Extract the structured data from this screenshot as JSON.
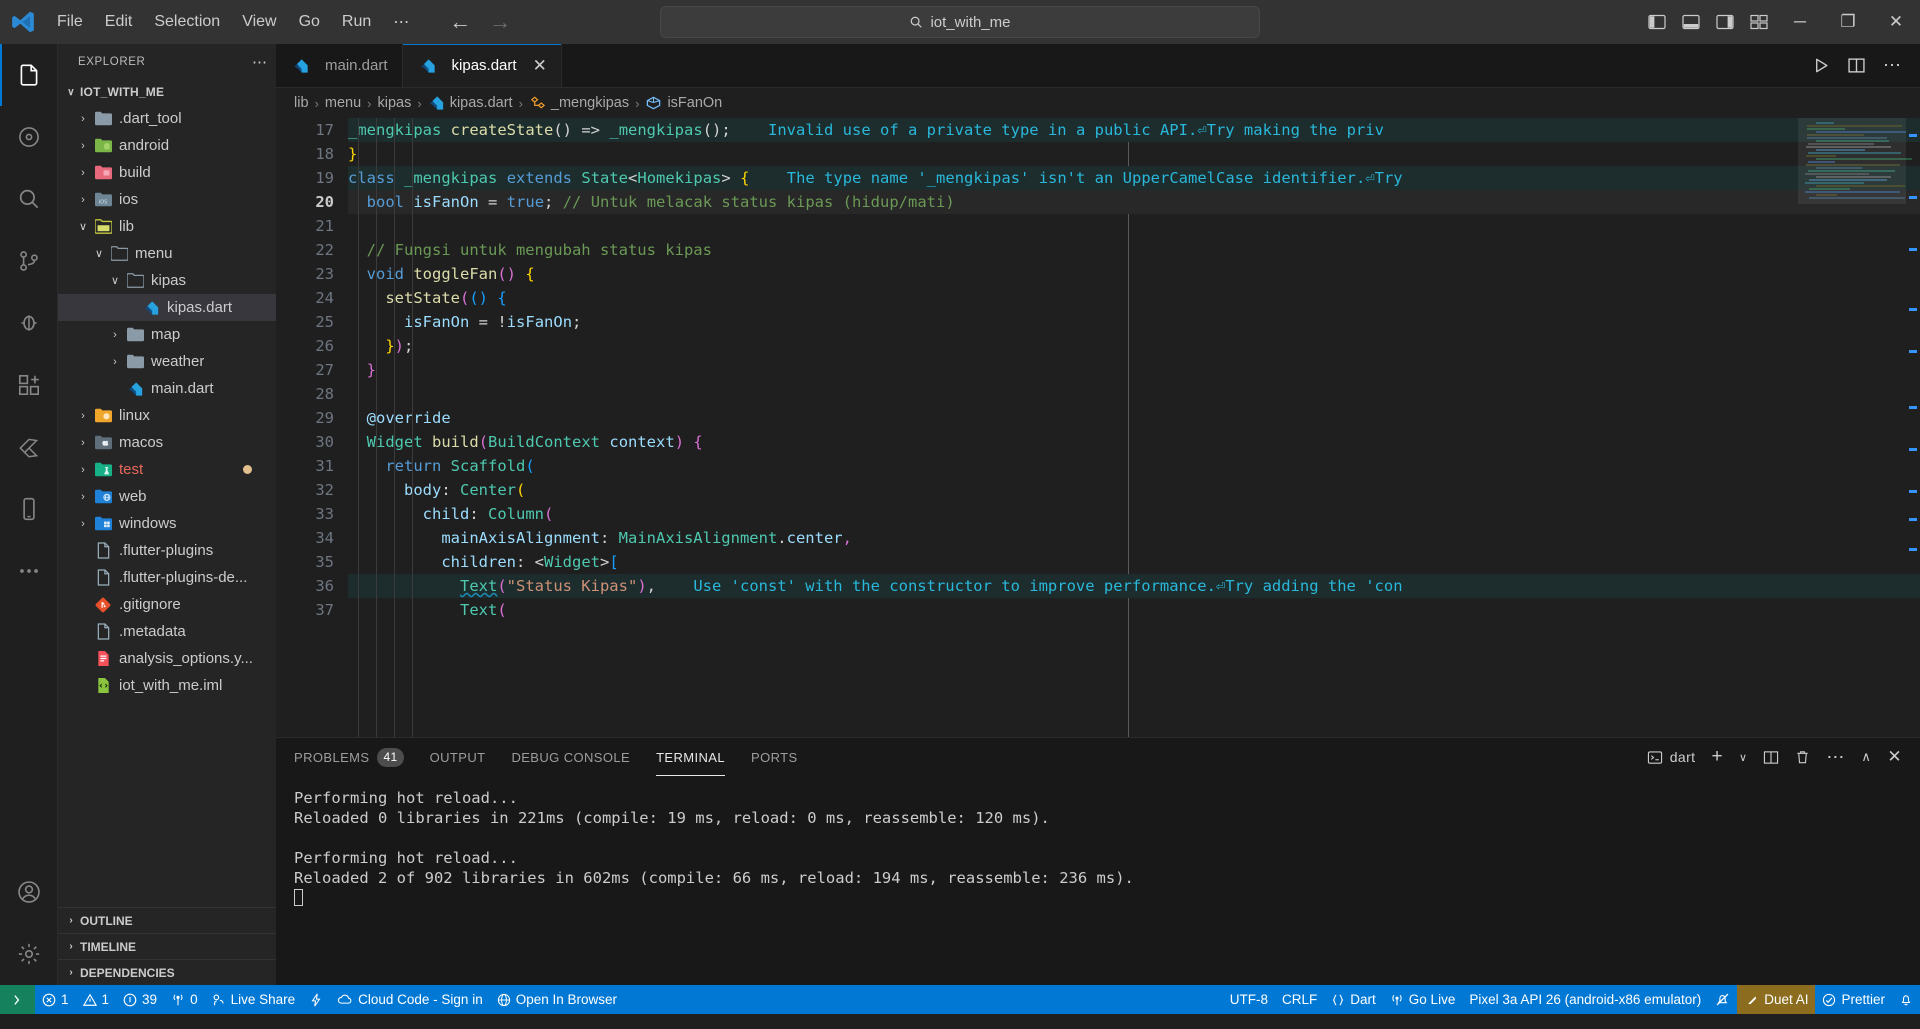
{
  "titlebar": {
    "logo": "vscode-logo",
    "menus": [
      "File",
      "Edit",
      "Selection",
      "View",
      "Go",
      "Run",
      "⋯"
    ],
    "nav_back": "←",
    "nav_forward": "→",
    "quickopen_text": "iot_with_me",
    "quickopen_icon": "search-icon",
    "window_controls": [
      "─",
      "❐",
      "✕"
    ]
  },
  "activitybar": {
    "items": [
      {
        "name": "explorer",
        "icon": "files-icon",
        "active": true,
        "badge": ""
      },
      {
        "name": "source-control-graph",
        "icon": "circle-nodes-icon",
        "active": false,
        "badge": ""
      },
      {
        "name": "search",
        "icon": "search-icon",
        "active": false,
        "badge": ""
      },
      {
        "name": "source-control",
        "icon": "source-control-icon",
        "active": false,
        "badge": ""
      },
      {
        "name": "run-and-debug",
        "icon": "debug-icon",
        "active": false,
        "badge": ""
      },
      {
        "name": "extensions",
        "icon": "extensions-icon",
        "active": false,
        "badge": ""
      },
      {
        "name": "flutter",
        "icon": "flutter-icon",
        "active": false,
        "badge": ""
      },
      {
        "name": "device-preview",
        "icon": "device-icon",
        "active": false,
        "badge": ""
      },
      {
        "name": "more-views",
        "icon": "ellipsis-icon",
        "active": false,
        "badge": ""
      }
    ],
    "bottom": [
      {
        "name": "accounts",
        "icon": "account-icon"
      },
      {
        "name": "settings",
        "icon": "gear-icon"
      }
    ]
  },
  "sidebar": {
    "title": "EXPLORER",
    "more_actions": "⋯",
    "root": "IOT_WITH_ME",
    "tree": [
      {
        "label": ".dart_tool",
        "depth": 1,
        "twist": "›",
        "icon": "folder-blue-gray",
        "selected": false,
        "modified": false
      },
      {
        "label": "android",
        "depth": 1,
        "twist": "›",
        "icon": "folder-android",
        "selected": false,
        "modified": false
      },
      {
        "label": "build",
        "depth": 1,
        "twist": "›",
        "icon": "folder-build",
        "selected": false,
        "modified": false
      },
      {
        "label": "ios",
        "depth": 1,
        "twist": "›",
        "icon": "folder-ios",
        "selected": false,
        "modified": false
      },
      {
        "label": "lib",
        "depth": 1,
        "twist": "∨",
        "icon": "folder-lib",
        "selected": false,
        "modified": false
      },
      {
        "label": "menu",
        "depth": 2,
        "twist": "∨",
        "icon": "folder-open-gray",
        "selected": false,
        "modified": false
      },
      {
        "label": "kipas",
        "depth": 3,
        "twist": "∨",
        "icon": "folder-open-gray",
        "selected": false,
        "modified": false
      },
      {
        "label": "kipas.dart",
        "depth": 4,
        "twist": "",
        "icon": "dart-file",
        "selected": true,
        "modified": false
      },
      {
        "label": "map",
        "depth": 3,
        "twist": "›",
        "icon": "folder-blue-gray",
        "selected": false,
        "modified": false
      },
      {
        "label": "weather",
        "depth": 3,
        "twist": "›",
        "icon": "folder-blue-gray",
        "selected": false,
        "modified": false
      },
      {
        "label": "main.dart",
        "depth": 3,
        "twist": "",
        "icon": "dart-file",
        "selected": false,
        "modified": false
      },
      {
        "label": "linux",
        "depth": 1,
        "twist": "›",
        "icon": "folder-linux",
        "selected": false,
        "modified": false
      },
      {
        "label": "macos",
        "depth": 1,
        "twist": "›",
        "icon": "folder-macos",
        "selected": false,
        "modified": false
      },
      {
        "label": "test",
        "depth": 1,
        "twist": "›",
        "icon": "folder-test",
        "selected": false,
        "modified": true
      },
      {
        "label": "web",
        "depth": 1,
        "twist": "›",
        "icon": "folder-web",
        "selected": false,
        "modified": false
      },
      {
        "label": "windows",
        "depth": 1,
        "twist": "›",
        "icon": "folder-windows",
        "selected": false,
        "modified": false
      },
      {
        "label": ".flutter-plugins",
        "depth": 1,
        "twist": "",
        "icon": "plain-file",
        "selected": false,
        "modified": false
      },
      {
        "label": ".flutter-plugins-de...",
        "depth": 1,
        "twist": "",
        "icon": "plain-file",
        "selected": false,
        "modified": false
      },
      {
        "label": ".gitignore",
        "depth": 1,
        "twist": "",
        "icon": "git-file",
        "selected": false,
        "modified": false
      },
      {
        "label": ".metadata",
        "depth": 1,
        "twist": "",
        "icon": "plain-file",
        "selected": false,
        "modified": false
      },
      {
        "label": "analysis_options.y...",
        "depth": 1,
        "twist": "",
        "icon": "yaml-file",
        "selected": false,
        "modified": false
      },
      {
        "label": "iot_with_me.iml",
        "depth": 1,
        "twist": "",
        "icon": "xml-file",
        "selected": false,
        "modified": false
      }
    ],
    "sections": [
      "OUTLINE",
      "TIMELINE",
      "DEPENDENCIES"
    ]
  },
  "editor": {
    "tabs": [
      {
        "label": "main.dart",
        "icon": "dart-file",
        "active": false,
        "closable": false
      },
      {
        "label": "kipas.dart",
        "icon": "dart-file",
        "active": true,
        "closable": true
      }
    ],
    "tab_actions": [
      "run-icon",
      "split-editor-icon",
      "more-actions-icon"
    ],
    "breadcrumb": [
      {
        "label": "lib",
        "icon": ""
      },
      {
        "label": "menu",
        "icon": ""
      },
      {
        "label": "kipas",
        "icon": ""
      },
      {
        "label": "kipas.dart",
        "icon": "dart-file"
      },
      {
        "label": "_mengkipas",
        "icon": "class-icon"
      },
      {
        "label": "isFanOn",
        "icon": "field-icon"
      }
    ],
    "first_line_number": 17,
    "cursor_line": 20,
    "lines": [
      {
        "n": 17,
        "html": "<span class='kw-type'>_mengkipas</span> <span class='fn'>createState</span><span class='punc'>()</span> <span class='op'>=&gt;</span> <span class='kw-type'>_mengkipas</span><span class='punc'>();</span>",
        "diag": "Invalid use of a private type in a public API.⏎Try making the priv",
        "hl": true
      },
      {
        "n": 18,
        "html": "<span class='punc-y'>}</span>",
        "diag": "",
        "hl": false
      },
      {
        "n": 19,
        "html": "<span class='kw'>class</span> <span class='kw-type'>_mengkipas</span> <span class='kw'>extends</span> <span class='kw-type'>State</span><span class='punc'>&lt;</span><span class='kw-type'>Homekipas</span><span class='punc'>&gt;</span> <span class='punc-y'>{</span>",
        "diag": "The type name '_mengkipas' isn't an UpperCamelCase identifier.⏎Try",
        "hl": true
      },
      {
        "n": 20,
        "html": "  <span class='kw'>bool</span> <span class='var'>isFanOn</span> <span class='op'>=</span> <span class='kw'>true</span><span class='punc'>;</span> <span class='cmt'>// Untuk melacak status kipas (hidup/mati)</span>",
        "diag": "",
        "hl": false
      },
      {
        "n": 21,
        "html": "",
        "diag": "",
        "hl": false
      },
      {
        "n": 22,
        "html": "  <span class='cmt'>// Fungsi untuk mengubah status kipas</span>",
        "diag": "",
        "hl": false
      },
      {
        "n": 23,
        "html": "  <span class='kw'>void</span> <span class='fn'>toggleFan</span><span class='punc-p'>()</span> <span class='punc-y'>{</span>",
        "diag": "",
        "hl": false
      },
      {
        "n": 24,
        "html": "    <span class='fn'>setState</span><span class='punc-p'>(</span><span class='punc-b'>()</span> <span class='punc-b'>{</span>",
        "diag": "",
        "hl": false
      },
      {
        "n": 25,
        "html": "      <span class='var'>isFanOn</span> <span class='op'>=</span> <span class='op'>!</span><span class='var'>isFanOn</span><span class='punc'>;</span>",
        "diag": "",
        "hl": false
      },
      {
        "n": 26,
        "html": "    <span class='punc-y'>}</span><span class='punc-p'>)</span><span class='punc'>;</span>",
        "diag": "",
        "hl": false
      },
      {
        "n": 27,
        "html": "  <span class='punc-p'>}</span>",
        "diag": "",
        "hl": false
      },
      {
        "n": 28,
        "html": "",
        "diag": "",
        "hl": false
      },
      {
        "n": 29,
        "html": "  <span class='ann'>@override</span>",
        "diag": "",
        "hl": false
      },
      {
        "n": 30,
        "html": "  <span class='kw-type'>Widget</span> <span class='fn'>build</span><span class='punc-p'>(</span><span class='kw-type'>BuildContext</span> <span class='var'>context</span><span class='punc-p'>)</span> <span class='punc-p'>{</span>",
        "diag": "",
        "hl": false
      },
      {
        "n": 31,
        "html": "    <span class='kw'>return</span> <span class='kw-type'>Scaffold</span><span class='punc-b'>(</span>",
        "diag": "",
        "hl": false
      },
      {
        "n": 32,
        "html": "      <span class='var'>body</span><span class='punc'>:</span> <span class='kw-type'>Center</span><span class='punc-y'>(</span>",
        "diag": "",
        "hl": false
      },
      {
        "n": 33,
        "html": "        <span class='var'>child</span><span class='punc'>:</span> <span class='kw-type'>Column</span><span class='punc-p'>(</span>",
        "diag": "",
        "hl": false
      },
      {
        "n": 34,
        "html": "          <span class='var'>mainAxisAlignment</span><span class='punc'>:</span> <span class='kw-type'>MainAxisAlignment</span><span class='punc'>.</span><span class='var'>center</span><span class='punc-o'>,</span>",
        "diag": "",
        "hl": false
      },
      {
        "n": 35,
        "html": "          <span class='var'>children</span><span class='punc'>:</span> <span class='punc'>&lt;</span><span class='kw-type'>Widget</span><span class='punc'>&gt;</span><span class='punc-b'>[</span>",
        "diag": "",
        "hl": false
      },
      {
        "n": 36,
        "html": "            <span class='kw-type squig'>Text</span><span class='punc-p'>(</span><span class='str'>\"Status Kipas\"</span><span class='punc-p'>)</span><span class='punc'>,</span>",
        "diag": "Use 'const' with the constructor to improve performance.⏎Try adding the 'con",
        "hl": true
      },
      {
        "n": 37,
        "html": "            <span class='kw-type'>Text</span><span class='punc-p'>(</span>",
        "diag": "",
        "hl": false
      }
    ]
  },
  "panel": {
    "tabs": [
      {
        "label": "PROBLEMS",
        "badge": "41",
        "active": false
      },
      {
        "label": "OUTPUT",
        "badge": "",
        "active": false
      },
      {
        "label": "DEBUG CONSOLE",
        "badge": "",
        "active": false
      },
      {
        "label": "TERMINAL",
        "badge": "",
        "active": true
      },
      {
        "label": "PORTS",
        "badge": "",
        "active": false
      }
    ],
    "terminal_chip": "dart",
    "actions": [
      "new-terminal-icon",
      "chevron-down-icon",
      "split-terminal-icon",
      "kill-terminal-icon",
      "more-actions-icon",
      "maximize-panel-icon",
      "close-panel-icon"
    ],
    "terminal_lines": [
      "Performing hot reload...",
      "Reloaded 0 libraries in 221ms (compile: 19 ms, reload: 0 ms, reassemble: 120 ms).",
      "",
      "Performing hot reload...",
      "Reloaded 2 of 902 libraries in 602ms (compile: 66 ms, reload: 194 ms, reassemble: 236 ms)."
    ]
  },
  "statusbar": {
    "remote_icon": "remote-window-icon",
    "left": [
      {
        "icon": "error-icon",
        "label": "1",
        "name": "errors-count"
      },
      {
        "icon": "warning-icon",
        "label": "1",
        "name": "warnings-count"
      },
      {
        "icon": "info-icon",
        "label": "39",
        "name": "infos-count"
      },
      {
        "icon": "radio-tower-icon",
        "label": "0",
        "name": "ports-count"
      },
      {
        "icon": "live-share-icon",
        "label": "Live Share",
        "name": "live-share"
      },
      {
        "icon": "zap-icon",
        "label": "",
        "name": "hot-reload"
      },
      {
        "icon": "cloud-icon",
        "label": "Cloud Code - Sign in",
        "name": "cloud-code-sign-in"
      },
      {
        "icon": "globe-icon",
        "label": "Open In Browser",
        "name": "open-in-browser"
      }
    ],
    "right": [
      {
        "icon": "",
        "label": "UTF-8",
        "name": "encoding"
      },
      {
        "icon": "",
        "label": "CRLF",
        "name": "eol"
      },
      {
        "icon": "braces-icon",
        "label": "Dart",
        "name": "language-mode"
      },
      {
        "icon": "broadcast-icon",
        "label": "Go Live",
        "name": "go-live"
      },
      {
        "icon": "",
        "label": "Pixel 3a API 26 (android-x86 emulator)",
        "name": "device-selector"
      },
      {
        "icon": "bell-slash-icon",
        "label": "",
        "name": "notifications-muted"
      },
      {
        "icon": "duet-icon",
        "label": "Duet AI",
        "name": "duet-ai",
        "highlight": true
      },
      {
        "icon": "check-circle-icon",
        "label": "Prettier",
        "name": "prettier"
      },
      {
        "icon": "bell-icon",
        "label": "",
        "name": "notifications"
      }
    ]
  },
  "colors": {
    "accent": "#0078d4",
    "remote_green": "#16825d",
    "duet_gold": "#8c6d1f",
    "badge_red": "#cc3434",
    "diag_cyan": "#29b8db"
  }
}
